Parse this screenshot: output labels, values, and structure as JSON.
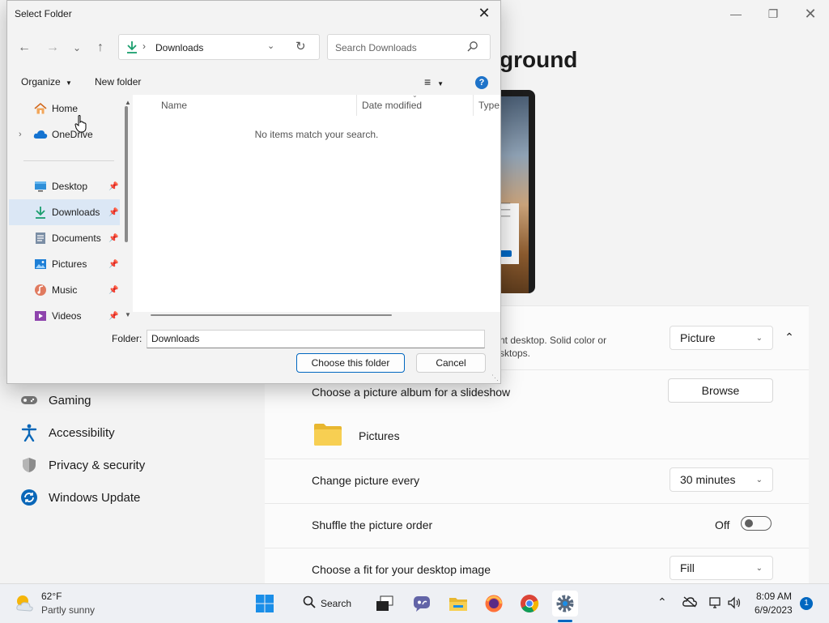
{
  "settings": {
    "title_partial": "ground",
    "nav": [
      {
        "label": "Gaming"
      },
      {
        "label": "Accessibility"
      },
      {
        "label": "Privacy & security"
      },
      {
        "label": "Windows Update"
      }
    ],
    "background_row": {
      "desc_line1": "nt desktop. Solid color or",
      "desc_line2": "sktops.",
      "value": "Picture"
    },
    "album_row": {
      "label": "Choose a picture album for a slideshow",
      "button": "Browse",
      "folder": "Pictures"
    },
    "change_row": {
      "label": "Change picture every",
      "value": "30 minutes"
    },
    "shuffle_row": {
      "label": "Shuffle the picture order",
      "state": "Off"
    },
    "fit_row": {
      "label": "Choose a fit for your desktop image",
      "value": "Fill"
    }
  },
  "dialog": {
    "title": "Select Folder",
    "address": "Downloads",
    "search_placeholder": "Search Downloads",
    "toolbar": {
      "organize": "Organize",
      "new_folder": "New folder"
    },
    "sidebar": [
      {
        "label": "Home"
      },
      {
        "label": "OneDrive"
      },
      {
        "label": "Desktop"
      },
      {
        "label": "Downloads"
      },
      {
        "label": "Documents"
      },
      {
        "label": "Pictures"
      },
      {
        "label": "Music"
      },
      {
        "label": "Videos"
      }
    ],
    "columns": {
      "name": "Name",
      "date": "Date modified",
      "type": "Type"
    },
    "empty_message": "No items match your search.",
    "folder_label": "Folder:",
    "folder_value": "Downloads",
    "choose_button": "Choose this folder",
    "cancel_button": "Cancel"
  },
  "taskbar": {
    "weather_temp": "62°F",
    "weather_desc": "Partly sunny",
    "search_label": "Search",
    "time": "8:09 AM",
    "date": "6/9/2023",
    "notification_count": "1"
  },
  "colors": {
    "accent": "#0067c0",
    "selected_bg": "#dbe7f5"
  }
}
